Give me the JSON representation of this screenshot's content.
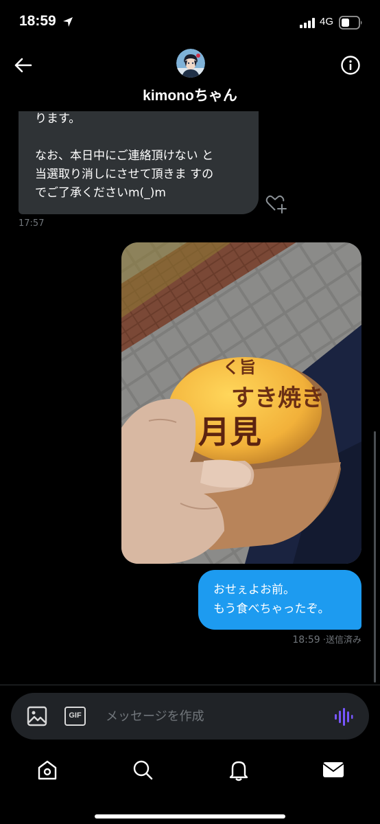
{
  "status": {
    "time": "18:59",
    "network": "4G"
  },
  "header": {
    "name": "kimonoちゃん",
    "back_icon": "back-arrow-icon",
    "info_icon": "info-icon"
  },
  "messages": {
    "received": {
      "text": "ります。\n\nなお、本日中にご連絡頂けない と\n当選取り消しにさせて頂きま すの\nでご了承くださいm(_)m",
      "time": "17:57",
      "reaction_icon": "add-reaction-heart-icon"
    },
    "photo": {
      "burger_text_top": "く旨",
      "burger_text_main": "すき焼き",
      "burger_text_big": "月見"
    },
    "sent": {
      "text": "おせぇよお前。\nもう食べちゃったぞ。",
      "time": "18:59",
      "status": "·送信済み"
    }
  },
  "composer": {
    "placeholder": "メッセージを作成",
    "gif_label": "GIF"
  },
  "nav": [
    "home-icon",
    "search-icon",
    "notifications-icon",
    "messages-icon"
  ],
  "colors": {
    "accent": "#1d9bf0",
    "received_bubble": "#2f3336",
    "background": "#000000",
    "voice": "#7856ff"
  }
}
